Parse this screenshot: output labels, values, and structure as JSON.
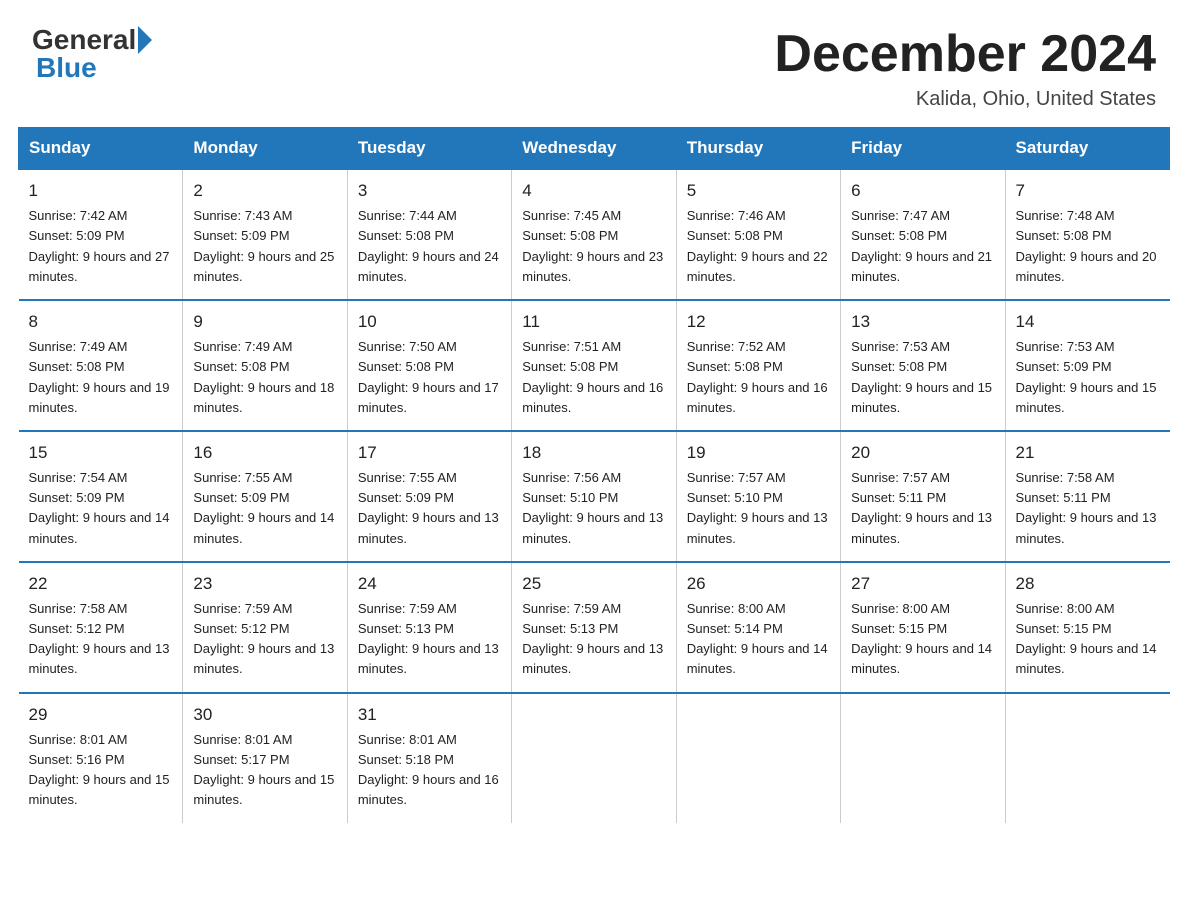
{
  "header": {
    "logo_general": "General",
    "logo_blue": "Blue",
    "month_year": "December 2024",
    "location": "Kalida, Ohio, United States"
  },
  "days_of_week": [
    "Sunday",
    "Monday",
    "Tuesday",
    "Wednesday",
    "Thursday",
    "Friday",
    "Saturday"
  ],
  "weeks": [
    [
      {
        "day": 1,
        "sunrise": "7:42 AM",
        "sunset": "5:09 PM",
        "daylight": "9 hours and 27 minutes."
      },
      {
        "day": 2,
        "sunrise": "7:43 AM",
        "sunset": "5:09 PM",
        "daylight": "9 hours and 25 minutes."
      },
      {
        "day": 3,
        "sunrise": "7:44 AM",
        "sunset": "5:08 PM",
        "daylight": "9 hours and 24 minutes."
      },
      {
        "day": 4,
        "sunrise": "7:45 AM",
        "sunset": "5:08 PM",
        "daylight": "9 hours and 23 minutes."
      },
      {
        "day": 5,
        "sunrise": "7:46 AM",
        "sunset": "5:08 PM",
        "daylight": "9 hours and 22 minutes."
      },
      {
        "day": 6,
        "sunrise": "7:47 AM",
        "sunset": "5:08 PM",
        "daylight": "9 hours and 21 minutes."
      },
      {
        "day": 7,
        "sunrise": "7:48 AM",
        "sunset": "5:08 PM",
        "daylight": "9 hours and 20 minutes."
      }
    ],
    [
      {
        "day": 8,
        "sunrise": "7:49 AM",
        "sunset": "5:08 PM",
        "daylight": "9 hours and 19 minutes."
      },
      {
        "day": 9,
        "sunrise": "7:49 AM",
        "sunset": "5:08 PM",
        "daylight": "9 hours and 18 minutes."
      },
      {
        "day": 10,
        "sunrise": "7:50 AM",
        "sunset": "5:08 PM",
        "daylight": "9 hours and 17 minutes."
      },
      {
        "day": 11,
        "sunrise": "7:51 AM",
        "sunset": "5:08 PM",
        "daylight": "9 hours and 16 minutes."
      },
      {
        "day": 12,
        "sunrise": "7:52 AM",
        "sunset": "5:08 PM",
        "daylight": "9 hours and 16 minutes."
      },
      {
        "day": 13,
        "sunrise": "7:53 AM",
        "sunset": "5:08 PM",
        "daylight": "9 hours and 15 minutes."
      },
      {
        "day": 14,
        "sunrise": "7:53 AM",
        "sunset": "5:09 PM",
        "daylight": "9 hours and 15 minutes."
      }
    ],
    [
      {
        "day": 15,
        "sunrise": "7:54 AM",
        "sunset": "5:09 PM",
        "daylight": "9 hours and 14 minutes."
      },
      {
        "day": 16,
        "sunrise": "7:55 AM",
        "sunset": "5:09 PM",
        "daylight": "9 hours and 14 minutes."
      },
      {
        "day": 17,
        "sunrise": "7:55 AM",
        "sunset": "5:09 PM",
        "daylight": "9 hours and 13 minutes."
      },
      {
        "day": 18,
        "sunrise": "7:56 AM",
        "sunset": "5:10 PM",
        "daylight": "9 hours and 13 minutes."
      },
      {
        "day": 19,
        "sunrise": "7:57 AM",
        "sunset": "5:10 PM",
        "daylight": "9 hours and 13 minutes."
      },
      {
        "day": 20,
        "sunrise": "7:57 AM",
        "sunset": "5:11 PM",
        "daylight": "9 hours and 13 minutes."
      },
      {
        "day": 21,
        "sunrise": "7:58 AM",
        "sunset": "5:11 PM",
        "daylight": "9 hours and 13 minutes."
      }
    ],
    [
      {
        "day": 22,
        "sunrise": "7:58 AM",
        "sunset": "5:12 PM",
        "daylight": "9 hours and 13 minutes."
      },
      {
        "day": 23,
        "sunrise": "7:59 AM",
        "sunset": "5:12 PM",
        "daylight": "9 hours and 13 minutes."
      },
      {
        "day": 24,
        "sunrise": "7:59 AM",
        "sunset": "5:13 PM",
        "daylight": "9 hours and 13 minutes."
      },
      {
        "day": 25,
        "sunrise": "7:59 AM",
        "sunset": "5:13 PM",
        "daylight": "9 hours and 13 minutes."
      },
      {
        "day": 26,
        "sunrise": "8:00 AM",
        "sunset": "5:14 PM",
        "daylight": "9 hours and 14 minutes."
      },
      {
        "day": 27,
        "sunrise": "8:00 AM",
        "sunset": "5:15 PM",
        "daylight": "9 hours and 14 minutes."
      },
      {
        "day": 28,
        "sunrise": "8:00 AM",
        "sunset": "5:15 PM",
        "daylight": "9 hours and 14 minutes."
      }
    ],
    [
      {
        "day": 29,
        "sunrise": "8:01 AM",
        "sunset": "5:16 PM",
        "daylight": "9 hours and 15 minutes."
      },
      {
        "day": 30,
        "sunrise": "8:01 AM",
        "sunset": "5:17 PM",
        "daylight": "9 hours and 15 minutes."
      },
      {
        "day": 31,
        "sunrise": "8:01 AM",
        "sunset": "5:18 PM",
        "daylight": "9 hours and 16 minutes."
      },
      null,
      null,
      null,
      null
    ]
  ]
}
